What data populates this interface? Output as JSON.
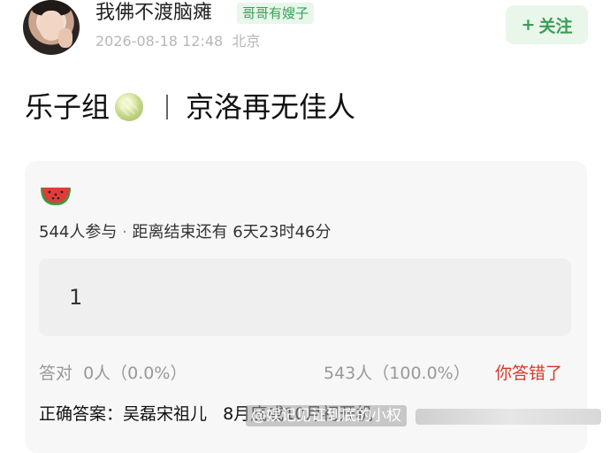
{
  "post": {
    "username": "我佛不渡脑瘫",
    "badge": "哥哥有嫂子",
    "meta": "2026-08-18 12:48  北京",
    "follow_label": "关注",
    "follow_plus": "+",
    "title_left": "乐子组",
    "title_right": "京洛再无佳人"
  },
  "quiz": {
    "participants": "544人参与",
    "separator": " · ",
    "countdown": "距离结束还有 6天23时46分",
    "option_text": "1",
    "correct_stat": "答对  0人（0.0%）",
    "wrong_stat": "543人（100.0%）",
    "wrong_tag": "你答错了",
    "answer_label": "正确答案：",
    "answer_value": "吴磊宋祖儿   8月底或10月初开机"
  },
  "watermark": {
    "text": "@娱记见证到底的小权"
  },
  "icons": {
    "melon": "melon-icon",
    "watermelon": "watermelon-icon"
  },
  "colors": {
    "accent_green": "#3a9d55",
    "badge_bg": "#e9f6ea",
    "wrong_red": "#d23a2c",
    "card_bg": "#f7f7f7"
  }
}
